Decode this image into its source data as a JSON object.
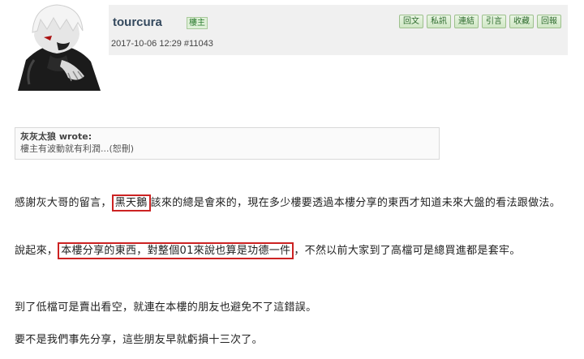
{
  "post": {
    "username": "tourcura",
    "role_badge": "樓主",
    "datetime": "2017-10-06 12:29",
    "post_number": "#11043",
    "actions": [
      "回文",
      "私訊",
      "連結",
      "引言",
      "收藏",
      "回報"
    ]
  },
  "quote": {
    "author": "灰灰太狼 wrote:",
    "text": "樓主有波動就有利潤...(恕刪)"
  },
  "body": {
    "p1_pre": "感謝灰大哥的留言，",
    "p1_hl": "黑天鵝",
    "p1_post": "該來的總是會來的，現在多少樓要透過本樓分享的東西才知道未來大盤的看法跟做法。",
    "p2_pre": "說起來，",
    "p2_hl": "本樓分享的東西，對整個01來說也算是功德一件",
    "p2_post": "，不然以前大家到了高檔可是總買進都是套牢。",
    "p3": "到了低檔可是賣出看空，就連在本樓的朋友也避免不了這錯誤。",
    "p4": "要不是我們事先分享，這些朋友早就虧損十三次了。"
  },
  "colors": {
    "header_bg": "#f0f0f0",
    "highlight_border": "#cc2222",
    "action_btn_bg": "#cfe6c4"
  }
}
